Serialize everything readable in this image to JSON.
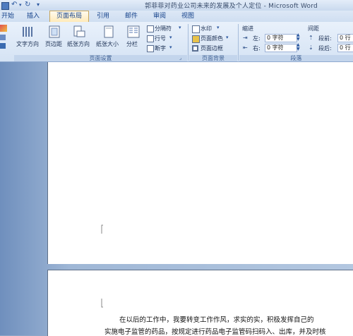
{
  "window": {
    "title": "郭菲菲对药业公司未来的发展及个人定位 - Microsoft Word"
  },
  "tabs": [
    {
      "label": "开始"
    },
    {
      "label": "插入"
    },
    {
      "label": "页面布局"
    },
    {
      "label": "引用"
    },
    {
      "label": "邮件"
    },
    {
      "label": "审阅"
    },
    {
      "label": "视图"
    }
  ],
  "ribbon": {
    "page_setup": {
      "text_direction": "文字方向",
      "margins": "页边距",
      "orientation": "纸张方向",
      "size": "纸张大小",
      "columns": "分栏",
      "breaks": "分隔符",
      "line_numbers": "行号",
      "hyphenation": "断字",
      "group_label": "页面设置"
    },
    "page_background": {
      "watermark": "水印",
      "page_color": "页面颜色",
      "page_borders": "页面边框",
      "group_label": "页面背景"
    },
    "paragraph": {
      "indent_header": "缩进",
      "spacing_header": "间距",
      "left_label": "左:",
      "right_label": "右:",
      "left_value": "0 字符",
      "right_value": "0 字符",
      "before_label": "段前:",
      "after_label": "段后:",
      "before_value": "0 行",
      "after_value": "0 行",
      "group_label": "段落"
    }
  },
  "document": {
    "line1": "在以后的工作中，我要转变工作作风，求实的实，积极发挥自己的",
    "line2": "实施电子监管的药品，按规定进行药品电子监管码扫码入、出库，并及时核"
  }
}
